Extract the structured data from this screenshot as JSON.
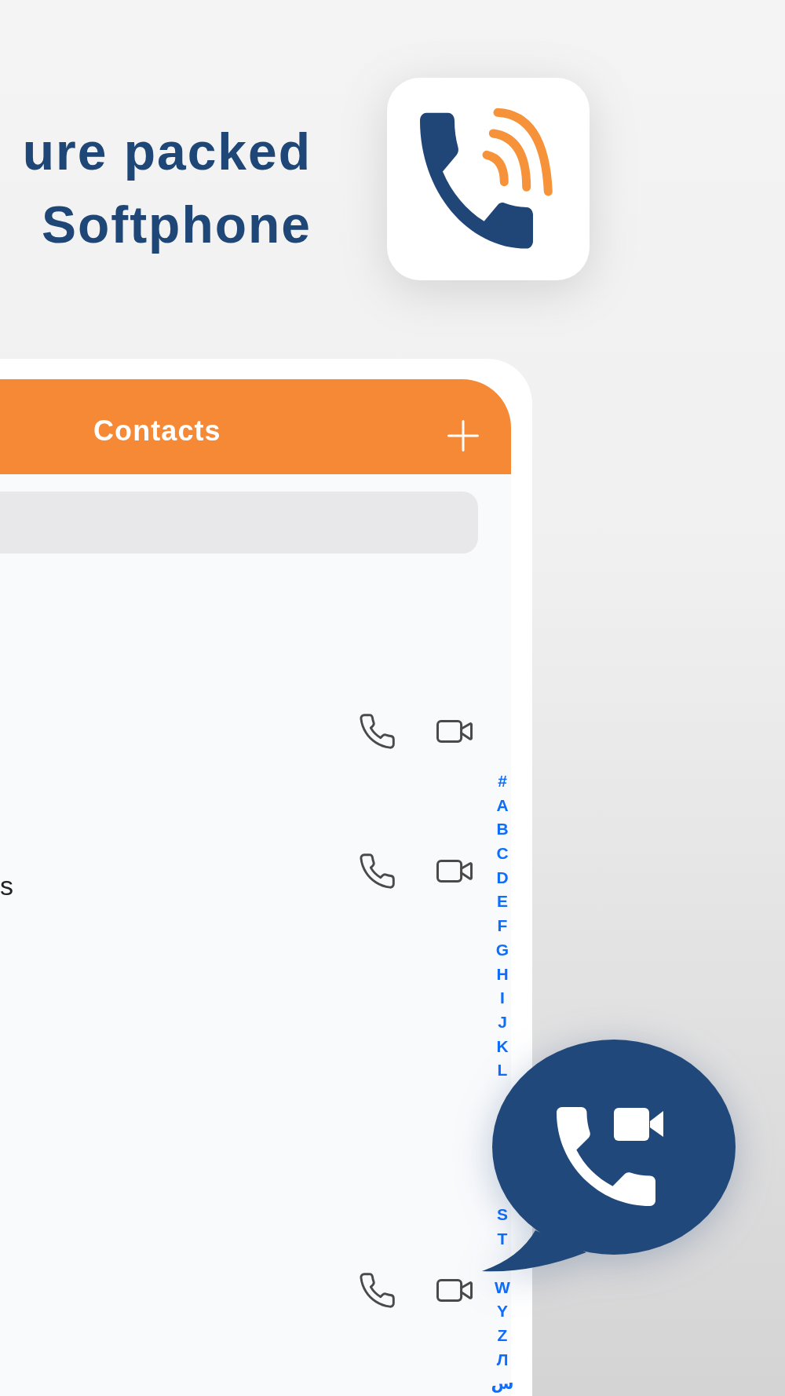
{
  "headline": {
    "lines": [
      "ure packed",
      "Softphone"
    ]
  },
  "screen": {
    "title": "Contacts",
    "contacts": [
      {
        "call_buttons": true
      },
      {
        "name": "s",
        "call_buttons": true
      },
      {
        "call_buttons": false
      },
      {
        "call_buttons": false
      },
      {
        "call_buttons": true
      }
    ],
    "index_groups": [
      [
        "#",
        "A",
        "B",
        "C",
        "D",
        "E",
        "F",
        "G",
        "H",
        "I",
        "J",
        "K",
        "L"
      ],
      [
        "S",
        "T"
      ],
      [
        "W",
        "Y",
        "Z",
        "Л",
        "س"
      ]
    ]
  }
}
